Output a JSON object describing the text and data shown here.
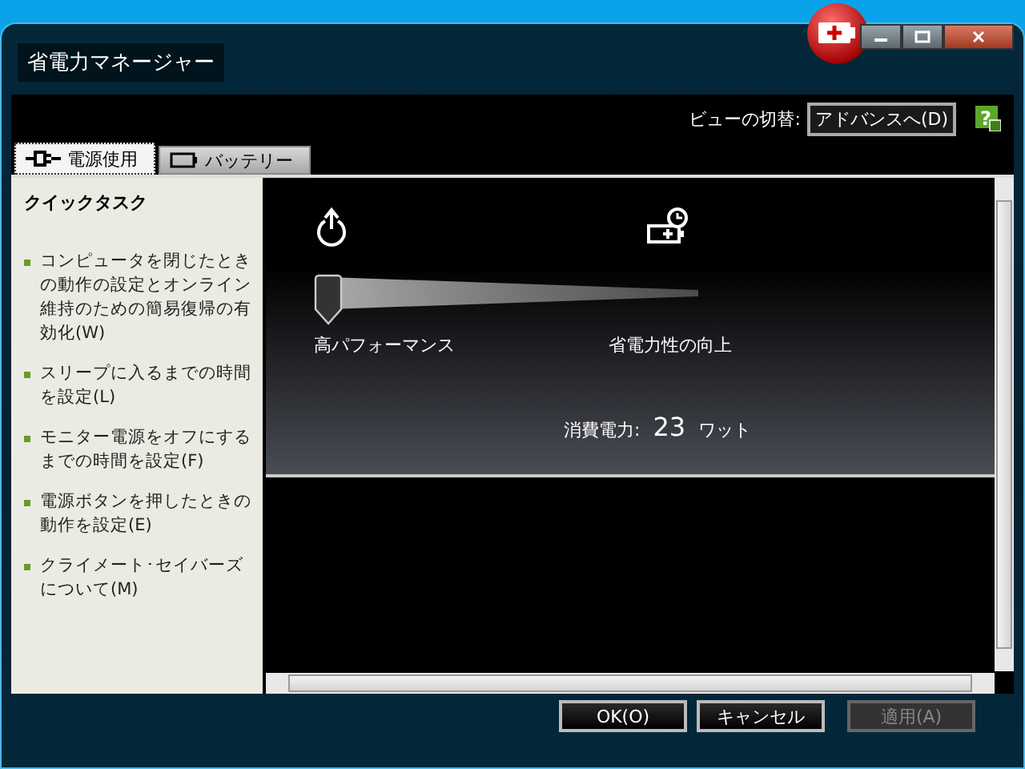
{
  "window": {
    "title": "省電力マネージャー"
  },
  "view_switch": {
    "label": "ビューの切替:",
    "button": "アドバンスへ(D)",
    "help": "?"
  },
  "tabs": [
    {
      "label": "電源使用",
      "selected": true,
      "kind": "plug"
    },
    {
      "label": "バッテリー",
      "selected": false,
      "kind": "battery"
    }
  ],
  "quick_tasks": {
    "title": "クイックタスク",
    "items": [
      "コンピュータを閉じたときの動作の設定とオンライン維持のための簡易復帰の有効化(W)",
      "スリープに入るまでの時間を設定(L)",
      "モニター電源をオフにするまでの時間を設定(F)",
      "電源ボタンを押したときの動作を設定(E)",
      "クライメート･セイバーズについて(M)"
    ]
  },
  "power_slider": {
    "level": 0,
    "left_label": "高パフォーマンス",
    "right_label": "省電力性の向上"
  },
  "consumption": {
    "label": "消費電力:",
    "value": "23",
    "unit": "ワット"
  },
  "buttons": [
    {
      "label": "OK(O)",
      "disabled": false
    },
    {
      "label": "キャンセル",
      "disabled": false
    },
    {
      "label": "適用(A)",
      "disabled": true
    }
  ]
}
